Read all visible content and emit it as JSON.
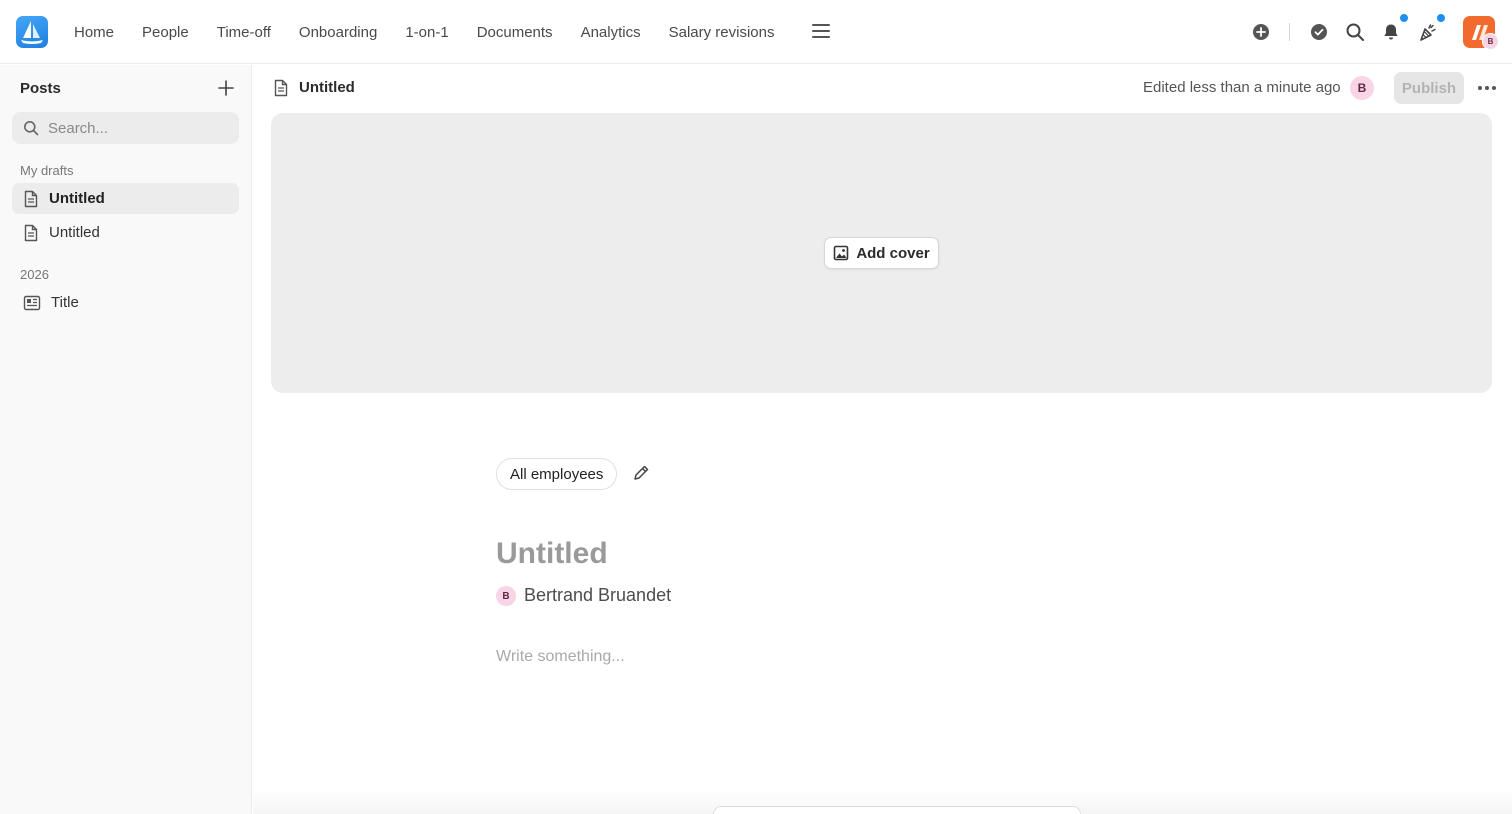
{
  "nav": {
    "items": [
      "Home",
      "People",
      "Time-off",
      "Onboarding",
      "1-on-1",
      "Documents",
      "Analytics",
      "Salary revisions"
    ],
    "icons": [
      "hamburger-icon",
      "plus-circle-icon",
      "check-circle-icon",
      "search-icon",
      "bell-icon",
      "celebration-icon"
    ],
    "company_avatar_initial": "B"
  },
  "sidebar": {
    "title": "Posts",
    "search_placeholder": "Search...",
    "sections": [
      {
        "label": "My drafts",
        "items": [
          {
            "label": "Untitled",
            "active": true
          },
          {
            "label": "Untitled",
            "active": false
          }
        ]
      },
      {
        "label": "2026",
        "items": [
          {
            "label": "Title",
            "active": false
          }
        ]
      }
    ]
  },
  "editor": {
    "doc_title": "Untitled",
    "edited_text": "Edited less than a minute ago",
    "editor_avatar_initial": "B",
    "publish_label": "Publish",
    "add_cover_label": "Add cover",
    "audience_label": "All employees",
    "post_title": "Untitled",
    "author_initial": "B",
    "author_name": "Bertrand Bruandet",
    "body_placeholder": "Write something..."
  },
  "colors": {
    "accent_blue": "#1d8ff2",
    "brand_orange": "#f26a2e",
    "avatar_pink": "#f7d4e6",
    "cover_gray": "#ededed"
  }
}
